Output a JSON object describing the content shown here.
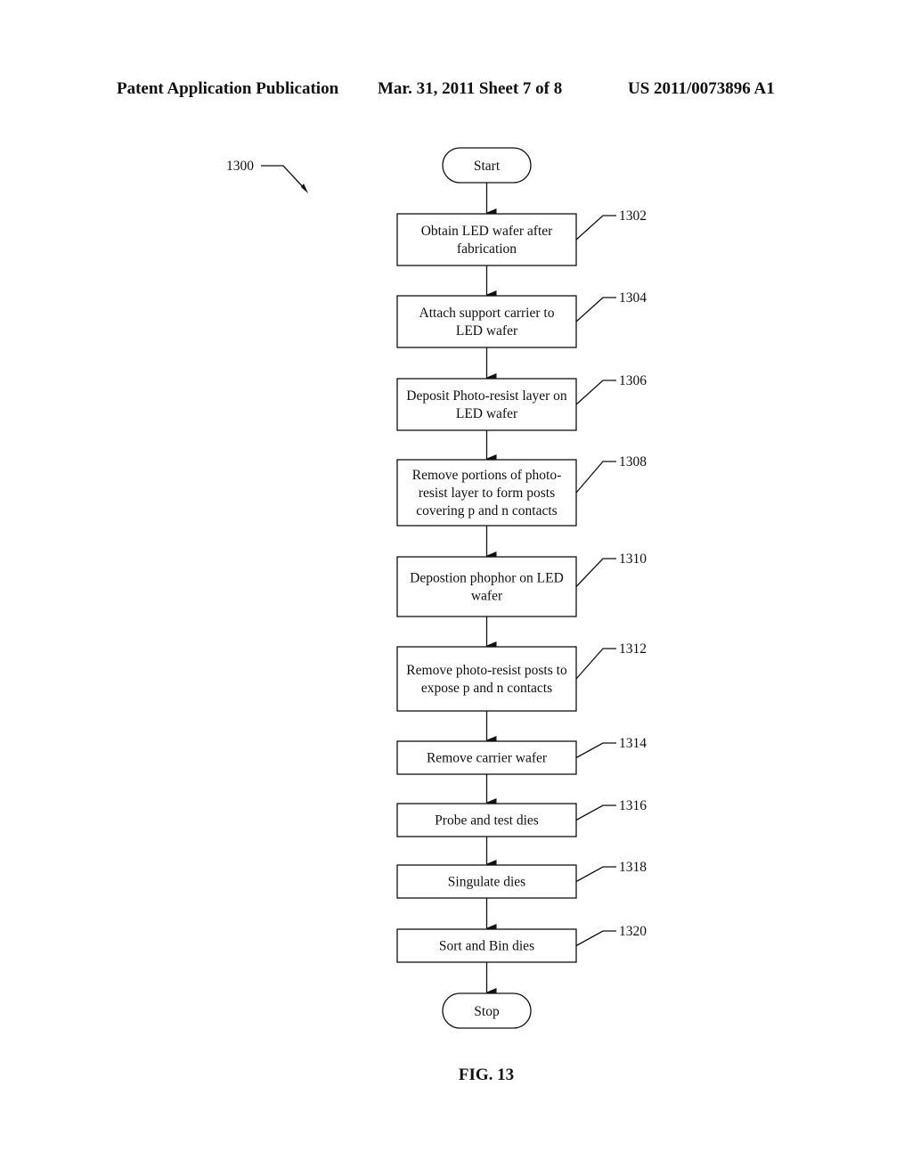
{
  "header": {
    "left": "Patent Application Publication",
    "middle": "Mar. 31, 2011  Sheet 7 of 8",
    "right": "US 2011/0073896 A1"
  },
  "diagram": {
    "ref": "1300",
    "start_label": "Start",
    "stop_label": "Stop",
    "steps": [
      {
        "ref": "1302",
        "lines": [
          "Obtain LED wafer after",
          "fabrication"
        ]
      },
      {
        "ref": "1304",
        "lines": [
          "Attach support carrier to",
          "LED wafer"
        ]
      },
      {
        "ref": "1306",
        "lines": [
          "Deposit Photo-resist layer on",
          "LED wafer"
        ]
      },
      {
        "ref": "1308",
        "lines": [
          "Remove portions of photo-",
          "resist layer to form posts",
          "covering p and n contacts"
        ]
      },
      {
        "ref": "1310",
        "lines": [
          "Depostion phophor on LED",
          "wafer"
        ]
      },
      {
        "ref": "1312",
        "lines": [
          "Remove photo-resist posts to",
          "expose p and n contacts"
        ]
      },
      {
        "ref": "1314",
        "lines": [
          "Remove carrier wafer"
        ]
      },
      {
        "ref": "1316",
        "lines": [
          "Probe and test dies"
        ]
      },
      {
        "ref": "1318",
        "lines": [
          "Singulate dies"
        ]
      },
      {
        "ref": "1320",
        "lines": [
          "Sort and Bin dies"
        ]
      }
    ]
  },
  "figure_label": "FIG. 13"
}
